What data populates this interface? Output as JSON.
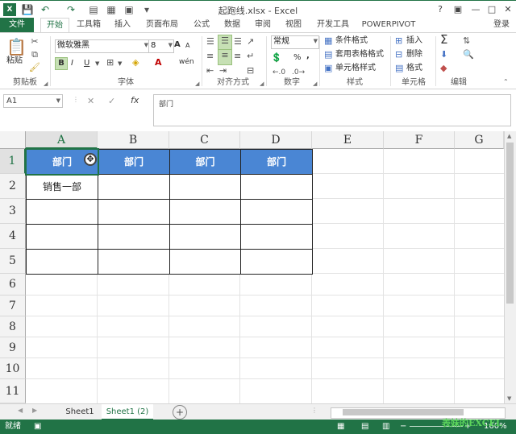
{
  "window": {
    "title": "起跑线.xlsx - Excel",
    "help": "?",
    "minimize": "—",
    "maximize": "□",
    "close": "✕",
    "account": "登录"
  },
  "qat": {
    "save": "💾",
    "undo": "↶",
    "redo": "↷"
  },
  "tabs": {
    "file": "文件",
    "items": [
      "开始",
      "工具箱",
      "插入",
      "页面布局",
      "公式",
      "数据",
      "审阅",
      "视图",
      "开发工具",
      "POWERPIVOT"
    ]
  },
  "ribbon": {
    "clipboard": {
      "label": "剪贴板",
      "paste": "粘贴"
    },
    "font": {
      "label": "字体",
      "name": "微软雅黑",
      "size": "8",
      "bold": "B",
      "italic": "I",
      "underline": "U",
      "grow": "A",
      "shrink": "A",
      "wen": "wén"
    },
    "alignment": {
      "label": "对齐方式"
    },
    "number": {
      "label": "数字",
      "format": "常规",
      "percent": "%",
      "comma": ","
    },
    "styles": {
      "label": "样式",
      "conditional": "条件格式",
      "table": "套用表格格式",
      "cell": "单元格样式"
    },
    "cells": {
      "label": "单元格",
      "insert": "插入",
      "delete": "删除",
      "format": "格式"
    },
    "editing": {
      "label": "编辑",
      "sum": "Σ"
    }
  },
  "formula_bar": {
    "name_box": "A1",
    "cancel": "✕",
    "enter": "✓",
    "fx": "fx",
    "content": "部门"
  },
  "columns": [
    "A",
    "B",
    "C",
    "D",
    "E",
    "F",
    "G"
  ],
  "rows": [
    "1",
    "2",
    "3",
    "4",
    "5",
    "6",
    "7",
    "8",
    "9",
    "10",
    "11"
  ],
  "cells": {
    "A1": "部门",
    "B1": "部门",
    "C1": "部门",
    "D1": "部门",
    "A2": "销售一部"
  },
  "sheets": {
    "tabs": [
      "Sheet1",
      "Sheet1 (2)"
    ],
    "active": 1,
    "add": "+"
  },
  "status": {
    "mode": "就绪",
    "zoom": "160%",
    "watermark": "表妹的EXCEL"
  },
  "colors": {
    "accent": "#217346",
    "header_fill": "#4a86d4"
  }
}
